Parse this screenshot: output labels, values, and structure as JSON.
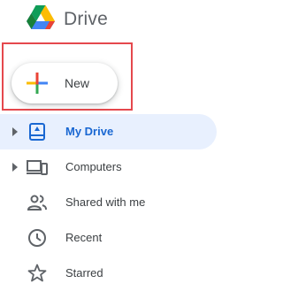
{
  "header": {
    "app_title": "Drive",
    "logo_icon": "google-drive-logo"
  },
  "new_button": {
    "label": "New",
    "icon": "plus-icon",
    "highlighted": true,
    "highlight_color": "#e5484d"
  },
  "sidebar": {
    "items": [
      {
        "label": "My Drive",
        "icon": "my-drive-icon",
        "active": true,
        "expandable": true
      },
      {
        "label": "Computers",
        "icon": "computers-icon",
        "active": false,
        "expandable": true
      },
      {
        "label": "Shared with me",
        "icon": "shared-with-me-icon",
        "active": false,
        "expandable": false
      },
      {
        "label": "Recent",
        "icon": "clock-icon",
        "active": false,
        "expandable": false
      },
      {
        "label": "Starred",
        "icon": "star-icon",
        "active": false,
        "expandable": false
      }
    ]
  },
  "colors": {
    "accent": "#1967d2",
    "active_background": "#e8f0fe",
    "text": "#3c4043",
    "icon": "#5f6368"
  }
}
